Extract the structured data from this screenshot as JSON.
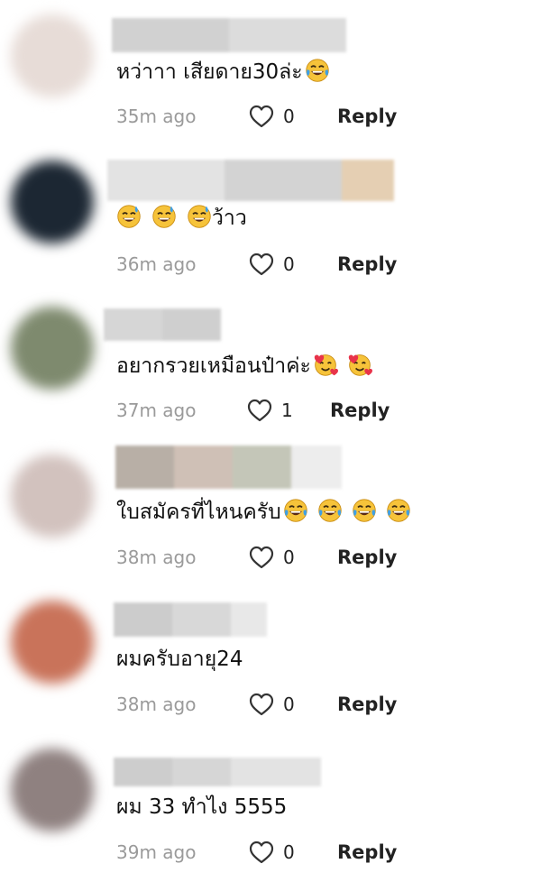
{
  "comments": [
    {
      "text": "หว่าาา เสียดาย30ล่ะ",
      "emoji": [
        "tears-of-joy"
      ],
      "time": "35m ago",
      "likes": "0",
      "reply": "Reply",
      "avatar_color": "#e7dcd7",
      "name_colors": [
        "#d1d1d1",
        "#dcdcdc"
      ]
    },
    {
      "text": "ว้าว",
      "emoji_before": [
        "sweat-smile",
        "sweat-smile",
        "sweat-smile"
      ],
      "time": "36m ago",
      "likes": "0",
      "reply": "Reply",
      "avatar_color": "#1c2733",
      "name_colors": [
        "#e3e3e3",
        "#d3d3d3",
        "#e5cfb3"
      ]
    },
    {
      "text": "อยากรวยเหมือนป๋าค่ะ",
      "emoji": [
        "smiling-hearts",
        "smiling-hearts"
      ],
      "time": "37m ago",
      "likes": "1",
      "reply": "Reply",
      "avatar_color": "#7e8a6e",
      "name_colors": [
        "#d6d6d6",
        "#cfcfcf"
      ]
    },
    {
      "text": "ใบสมัครที่ไหนครับ",
      "emoji": [
        "tears-of-joy",
        "tears-of-joy",
        "tears-of-joy",
        "tears-of-joy"
      ],
      "time": "38m ago",
      "likes": "0",
      "reply": "Reply",
      "avatar_color": "#d2c2be",
      "name_colors": [
        "#b8afa6",
        "#cfc0b6",
        "#c4c6b8",
        "#ededed"
      ]
    },
    {
      "text": "ผมครับอายุ24",
      "time": "38m ago",
      "likes": "0",
      "reply": "Reply",
      "avatar_color": "#c9735a",
      "name_colors": [
        "#cccccc",
        "#d8d8d8",
        "#e8e8e8"
      ]
    },
    {
      "text": "ผม 33 ทำไง 5555",
      "time": "39m ago",
      "likes": "0",
      "reply": "Reply",
      "avatar_color": "#8f8180",
      "name_colors": [
        "#cdcdcd",
        "#d6d6d6",
        "#e3e3e3"
      ]
    }
  ]
}
